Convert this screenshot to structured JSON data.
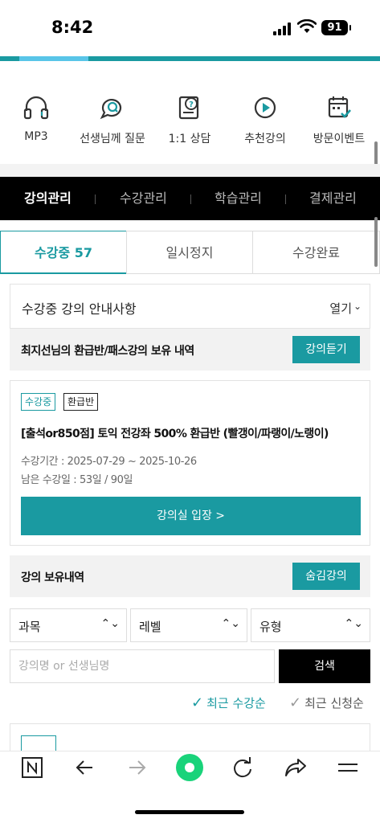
{
  "status_bar": {
    "time": "8:42",
    "battery": "91"
  },
  "quick_menu": [
    {
      "label": "MP3",
      "icon": "headphones-icon"
    },
    {
      "label": "선생님께 질문",
      "icon": "chat-question-icon"
    },
    {
      "label": "1:1 상담",
      "icon": "consult-icon"
    },
    {
      "label": "추천강의",
      "icon": "play-circle-icon"
    },
    {
      "label": "방문이벤트",
      "icon": "calendar-check-icon"
    }
  ],
  "top_nav": [
    "강의관리",
    "수강관리",
    "학습관리",
    "결제관리"
  ],
  "sub_tabs": [
    "수강중 57",
    "일시정지",
    "수강완료"
  ],
  "notice": {
    "text": "수강중 강의 안내사항",
    "toggle": "열기"
  },
  "owned_section": {
    "title": "최지선님의 환급반/패스강의 보유 내역",
    "button": "강의듣기"
  },
  "course_card": {
    "badges": [
      "수강중",
      "환급반"
    ],
    "title": "[출석or850점] 토익 전강좌 500% 환급반 (빨갱이/파랭이/노랭이)",
    "period": "수강기간 : 2025-07-29 ~ 2025-10-26",
    "remaining": "남은 수강일 : 53일 / 90일",
    "enter_button": "강의실 입장 >"
  },
  "lecture_section": {
    "title": "강의 보유내역",
    "button": "숨김강의"
  },
  "filters": [
    "과목",
    "레벨",
    "유형"
  ],
  "search": {
    "placeholder": "강의명 or 선생님명",
    "button": "검색"
  },
  "sort": [
    "최근 수강순",
    "최근 신청순"
  ],
  "colors": {
    "accent": "#1a9aa1",
    "black": "#000000"
  }
}
